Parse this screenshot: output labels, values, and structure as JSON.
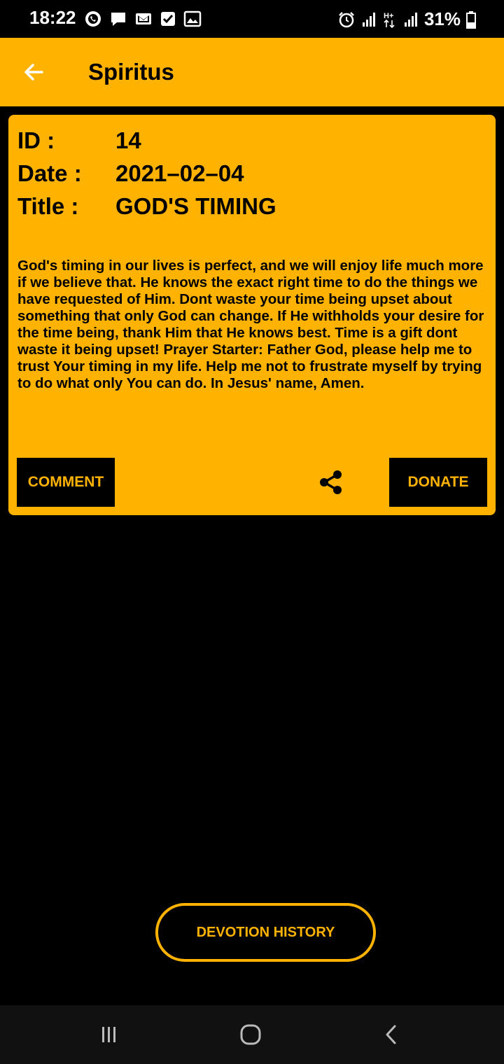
{
  "status_bar": {
    "time": "18:22",
    "battery": "31%",
    "left_icons": [
      "whatsapp-icon",
      "message-icon",
      "gmail-icon",
      "checkbox-icon",
      "gallery-icon"
    ],
    "right_icons": [
      "alarm-icon",
      "signal-icon",
      "hplus-data-icon",
      "signal-icon-2",
      "battery-icon"
    ]
  },
  "app_bar": {
    "title": "Spiritus"
  },
  "devotion": {
    "id_label": "ID :",
    "id_value": "14",
    "date_label": "Date :",
    "date_value": "2021–02–04",
    "title_label": "Title :",
    "title_value": "GOD'S TIMING",
    "body": "God's timing in our lives is perfect, and we will enjoy life much more if we believe that. He knows the exact right time to do the things we have requested of Him. Dont waste your time being upset about something that only God can change. If He withholds your desire for the time being, thank Him that He knows best. Time is a gift dont waste it being upset! Prayer Starter: Father God, please help me to trust Your timing in my life. Help me not to frustrate myself by trying to do what only You can do. In Jesus' name, Amen."
  },
  "actions": {
    "comment_label": "COMMENT",
    "donate_label": "DONATE",
    "history_label": "DEVOTION HISTORY"
  },
  "colors": {
    "accent": "#FFB300",
    "background": "#000000"
  }
}
